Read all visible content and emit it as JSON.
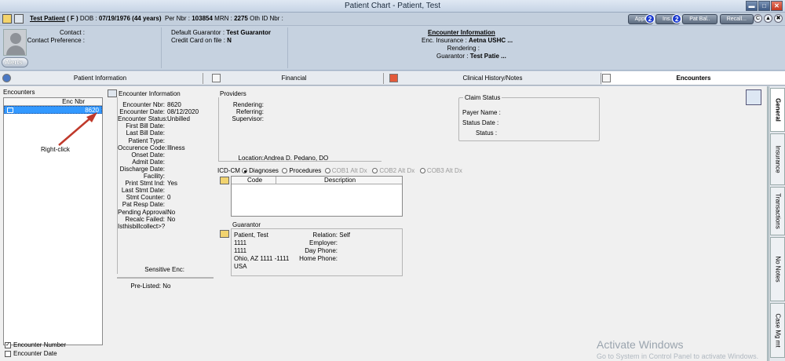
{
  "window": {
    "title": "Patient Chart - Patient, Test",
    "min": "▬",
    "max": "□",
    "close": "✕"
  },
  "patient": {
    "name": "Test Patient",
    "sex": "( F )",
    "dob_label": "DOB :",
    "dob": "07/19/1976 (44 years)",
    "per_nbr_label": "Per Nbr :",
    "per_nbr": "103854",
    "mrn_label": "MRN :",
    "mrn": "2275",
    "oth_id_label": "Oth ID Nbr :"
  },
  "top_buttons": [
    {
      "label": "Appt",
      "badge": "2"
    },
    {
      "label": "Ins..",
      "badge": "2"
    },
    {
      "label": "Pat Bal..",
      "badge": ""
    },
    {
      "label": "Recall...",
      "badge": ""
    }
  ],
  "mini_buttons": [
    "C",
    "▲",
    "✖"
  ],
  "contact": {
    "contact_label": "Contact :",
    "contact_pref_label": "Contact Preference :",
    "alerts": "Alerts",
    "guarantor_label": "Default Guarantor :",
    "guarantor": "Test Guarantor",
    "cc_label": "Credit Card on file :",
    "cc": "N",
    "enc_info_title": "Encounter Information",
    "enc_ins_label": "Enc. Insurance :",
    "enc_ins": "Aetna USHC ...",
    "rendering_label": "Rendering :",
    "enc_guar_label": "Guarantor :",
    "enc_guar": "Test Patie ..."
  },
  "tabs": [
    {
      "label": "Patient Information"
    },
    {
      "label": "Financial"
    },
    {
      "label": "Clinical History/Notes"
    },
    {
      "label": "Encounters"
    }
  ],
  "encounters": {
    "title": "Encounters",
    "column": "Enc Nbr",
    "rows": [
      {
        "enc_nbr": "8620"
      }
    ],
    "annotation": "Right-click",
    "check_enc_number": "Encounter Number",
    "check_enc_date": "Encounter Date"
  },
  "enc_info": {
    "title": "Encounter Information",
    "fields": [
      {
        "k": "Encounter Nbr:",
        "v": "8620"
      },
      {
        "k": "Encounter Date:",
        "v": "08/12/2020"
      },
      {
        "k": "Encounter Status:",
        "v": "Unbilled"
      },
      {
        "k": "First Bill Date:",
        "v": ""
      },
      {
        "k": "Last Bill Date:",
        "v": ""
      },
      {
        "k": "Patient Type:",
        "v": ""
      },
      {
        "k": "Occurence Code:",
        "v": "Illness"
      },
      {
        "k": "Onset Date:",
        "v": ""
      },
      {
        "k": "Admit Date:",
        "v": ""
      },
      {
        "k": "Discharge Date:",
        "v": ""
      },
      {
        "k": "Facility:",
        "v": ""
      },
      {
        "k": "Print Stmt Ind:",
        "v": "Yes"
      },
      {
        "k": "Last Stmt Date:",
        "v": ""
      },
      {
        "k": "Stmt Counter:",
        "v": "0"
      },
      {
        "k": "Pat Resp Date:",
        "v": ""
      },
      {
        "k": "Pending Approval:",
        "v": "No"
      },
      {
        "k": "Recalc Failed:",
        "v": "No"
      },
      {
        "k": "Isthisbillcollect>?",
        "v": ""
      }
    ],
    "sensitive": "Sensitive Enc:",
    "prelisted_label": "Pre-Listed:",
    "prelisted": "No"
  },
  "providers": {
    "title": "Providers",
    "rendering": "Rendering:",
    "referring": "Referring:",
    "supervisor": "Supervisor:",
    "location_label": "Location:",
    "location": "Andrea D. Pedano, DO"
  },
  "claim": {
    "title": "Claim Status",
    "payer": "Payer Name :",
    "status_date": "Status Date :",
    "status": "Status :"
  },
  "icd": {
    "label": "ICD-CM",
    "options": [
      "Diagnoses",
      "Procedures",
      "COB1 Alt Dx",
      "COB2 Alt Dx",
      "COB3 Alt Dx"
    ],
    "code_col": "Code",
    "desc_col": "Description"
  },
  "guarantor": {
    "title": "Guarantor",
    "name": "Patient, Test",
    "addr1": "1111",
    "addr2": "1111",
    "city": "Ohio, AZ 1111 -1111",
    "country": "USA",
    "relation_label": "Relation:",
    "relation": "Self",
    "employer_label": "Employer:",
    "day_phone_label": "Day Phone:",
    "home_phone_label": "Home Phone:"
  },
  "vtabs": [
    "General",
    "Insurance",
    "Transactions",
    "No Notes",
    "Case Mg mt"
  ],
  "watermark": {
    "title": "Activate Windows",
    "sub": "Go to System in Control Panel to activate Windows."
  },
  "colors": {
    "selection": "#3399ff",
    "arrow": "#c0392b",
    "badge": "#1c3ccf"
  }
}
